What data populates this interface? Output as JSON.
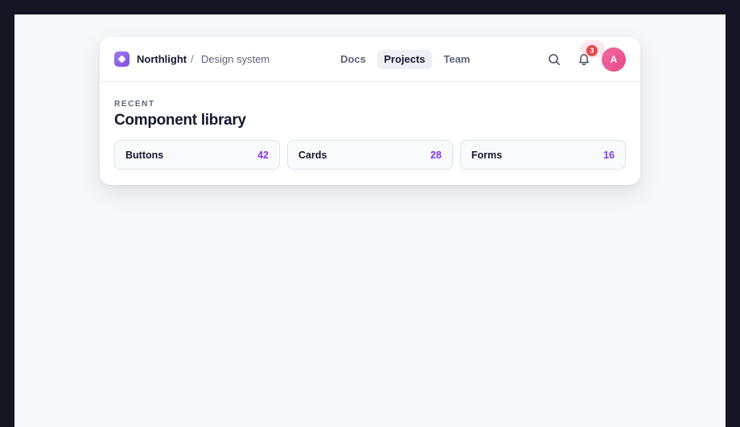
{
  "header": {
    "brand": "Northlight",
    "separator": "/",
    "breadcrumb": "Design system"
  },
  "nav": {
    "items": [
      {
        "label": "Docs",
        "active": false
      },
      {
        "label": "Projects",
        "active": true
      },
      {
        "label": "Team",
        "active": false
      }
    ]
  },
  "actions": {
    "search_icon": "search-icon",
    "bell_icon": "bell-icon",
    "notification_count": "3",
    "avatar_initial": "A"
  },
  "section": {
    "eyebrow": "RECENT",
    "title": "Component library"
  },
  "tiles": [
    {
      "label": "Buttons",
      "count": "42"
    },
    {
      "label": "Cards",
      "count": "28"
    },
    {
      "label": "Forms",
      "count": "16"
    }
  ],
  "colors": {
    "accent": "#7c3aed",
    "badge": "#e5484d",
    "avatar": "#ec4899"
  }
}
